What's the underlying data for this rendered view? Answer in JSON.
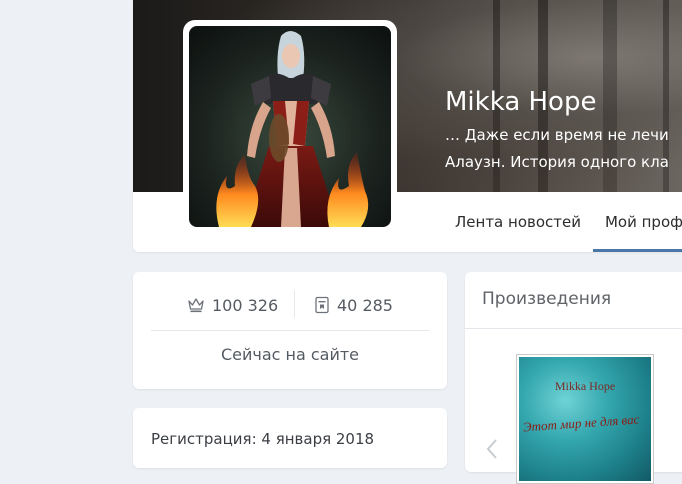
{
  "profile": {
    "name": "Mikka Hope",
    "status_line1": "… Даже если время не лечи",
    "status_line2": "Алаузн. История одного кла"
  },
  "tabs": [
    {
      "label": "Лента новостей",
      "active": false
    },
    {
      "label": "Мой проф",
      "active": true
    }
  ],
  "stats": {
    "rating": "100 326",
    "rating_icon": "crown-icon",
    "books": "40 285",
    "books_icon": "book-icon",
    "online_status": "Сейчас на сайте"
  },
  "info": {
    "registration": "Регистрация: 4 января 2018"
  },
  "works": {
    "title": "Произведения",
    "book": {
      "author": "Mikka Hope",
      "title": "Этот мир не для вас"
    }
  },
  "colors": {
    "accent": "#4a76a8",
    "background": "#edf0f5"
  }
}
